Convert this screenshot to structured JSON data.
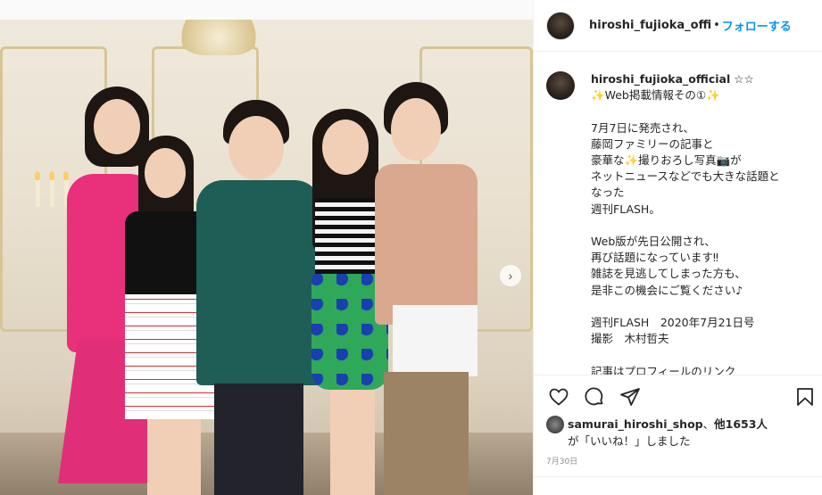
{
  "post": {
    "username": "hiroshi_fujioka_offi",
    "separator": "•",
    "follow_label": "フォローする"
  },
  "caption": {
    "username": "hiroshi_fujioka_official",
    "stars": "☆☆",
    "lines": [
      "✨Web掲載情報その①✨",
      "",
      "7月7日に発売され、",
      "藤岡ファミリーの記事と",
      "豪華な✨撮りおろし写真📷が",
      "ネットニュースなどでも大きな話題と",
      "なった",
      "週刊FLASH。",
      "",
      "Web版が先日公開され、",
      "再び話題になっています‼",
      "雑誌を見逃してしまった方も、",
      "是非この機会にご覧ください♪",
      "",
      "週刊FLASH　2020年7月21日号",
      "撮影　木村哲夫",
      "",
      "記事はプロフィールのリンク"
    ]
  },
  "likes": {
    "user": "samurai_hiroshi_shop",
    "sep": "、",
    "others": "他1653人",
    "suffix": "が「いいね！」しました"
  },
  "date": "7月30日",
  "icons": {
    "like": "heart-icon",
    "comment": "comment-icon",
    "share": "share-icon",
    "save": "bookmark-icon",
    "next": "chevron-right-icon"
  }
}
